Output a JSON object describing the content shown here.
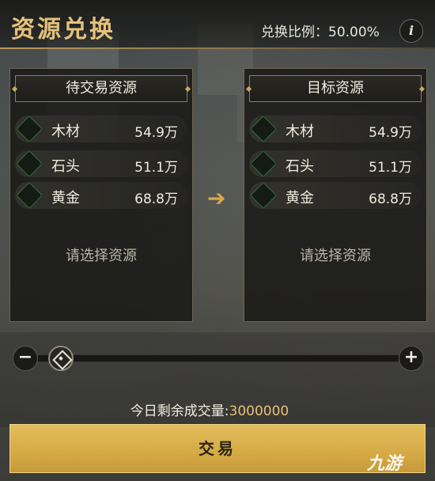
{
  "header": {
    "title": "资源兑换",
    "ratio_text": "兑换比例：50.00%",
    "info_label": "i"
  },
  "left_panel": {
    "title": "待交易资源",
    "items": [
      {
        "name": "木材",
        "value": "54.9万"
      },
      {
        "name": "石头",
        "value": "51.1万"
      },
      {
        "name": "黄金",
        "value": "68.8万"
      }
    ],
    "placeholder": "请选择资源"
  },
  "right_panel": {
    "title": "目标资源",
    "items": [
      {
        "name": "木材",
        "value": "54.9万"
      },
      {
        "name": "石头",
        "value": "51.1万"
      },
      {
        "name": "黄金",
        "value": "68.8万"
      }
    ],
    "placeholder": "请选择资源"
  },
  "arrow": "➔",
  "slider": {
    "minus_label": "−",
    "plus_label": "+",
    "level": 0
  },
  "remain": {
    "label": "今日剩余成交量:",
    "value": "3000000"
  },
  "trade_button_label": "交易",
  "watermark": "九游",
  "colors": {
    "accent_gold": "#e5c27a",
    "button_gold": "#d5aa45",
    "panel_border": "#6e6552"
  }
}
